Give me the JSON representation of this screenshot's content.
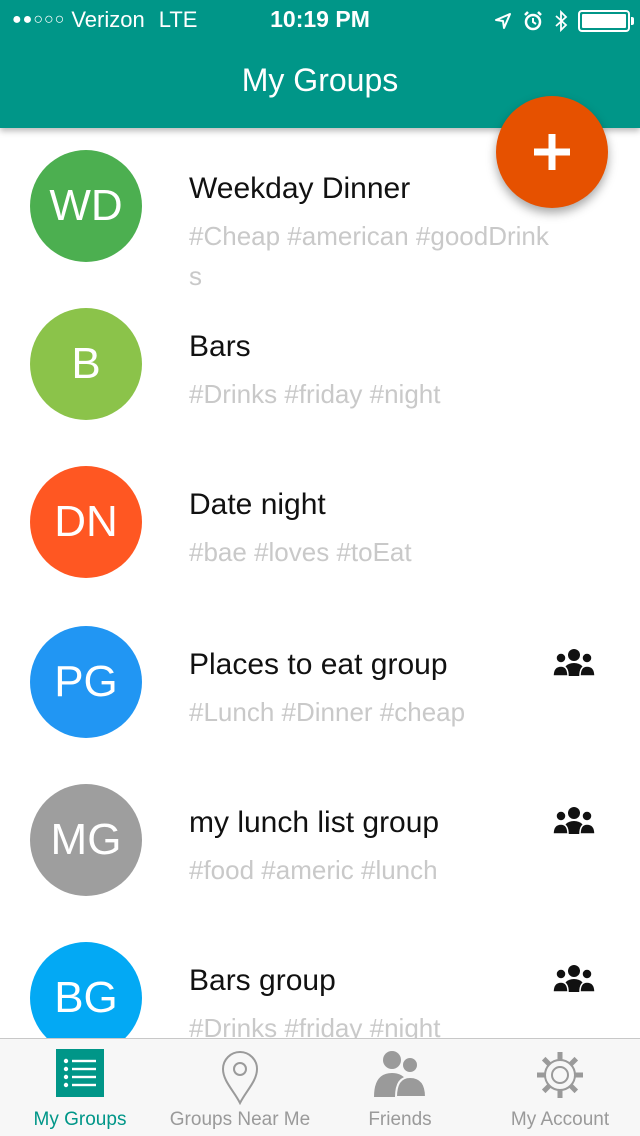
{
  "status_bar": {
    "carrier": "Verizon",
    "network": "LTE",
    "time": "10:19 PM"
  },
  "header": {
    "title": "My Groups"
  },
  "add_button": {
    "label": "+"
  },
  "groups": [
    {
      "initials": "WD",
      "name": "Weekday Dinner",
      "tags": "#Cheap #american #goodDrinks",
      "color": "#4caf50",
      "shared": false
    },
    {
      "initials": "B",
      "name": "Bars",
      "tags": "#Drinks #friday #night",
      "color": "#8bc34a",
      "shared": false
    },
    {
      "initials": "DN",
      "name": "Date night",
      "tags": "#bae #loves #toEat",
      "color": "#ff5722",
      "shared": false
    },
    {
      "initials": "PG",
      "name": "Places to eat group",
      "tags": "#Lunch #Dinner #cheap",
      "color": "#2196f3",
      "shared": true
    },
    {
      "initials": "MG",
      "name": "my lunch list group",
      "tags": "#food #americ #lunch",
      "color": "#9e9e9e",
      "shared": true
    },
    {
      "initials": "BG",
      "name": "Bars group",
      "tags": "#Drinks #friday #night",
      "color": "#03a9f4",
      "shared": true
    }
  ],
  "tabs": [
    {
      "label": "My Groups",
      "icon": "list-icon",
      "active": true
    },
    {
      "label": "Groups Near Me",
      "icon": "location-pin-icon",
      "active": false
    },
    {
      "label": "Friends",
      "icon": "friends-icon",
      "active": false
    },
    {
      "label": "My Account",
      "icon": "gear-icon",
      "active": false
    }
  ],
  "colors": {
    "primary": "#009688",
    "accent": "#e65100",
    "tag_text": "#c9c9c9"
  }
}
